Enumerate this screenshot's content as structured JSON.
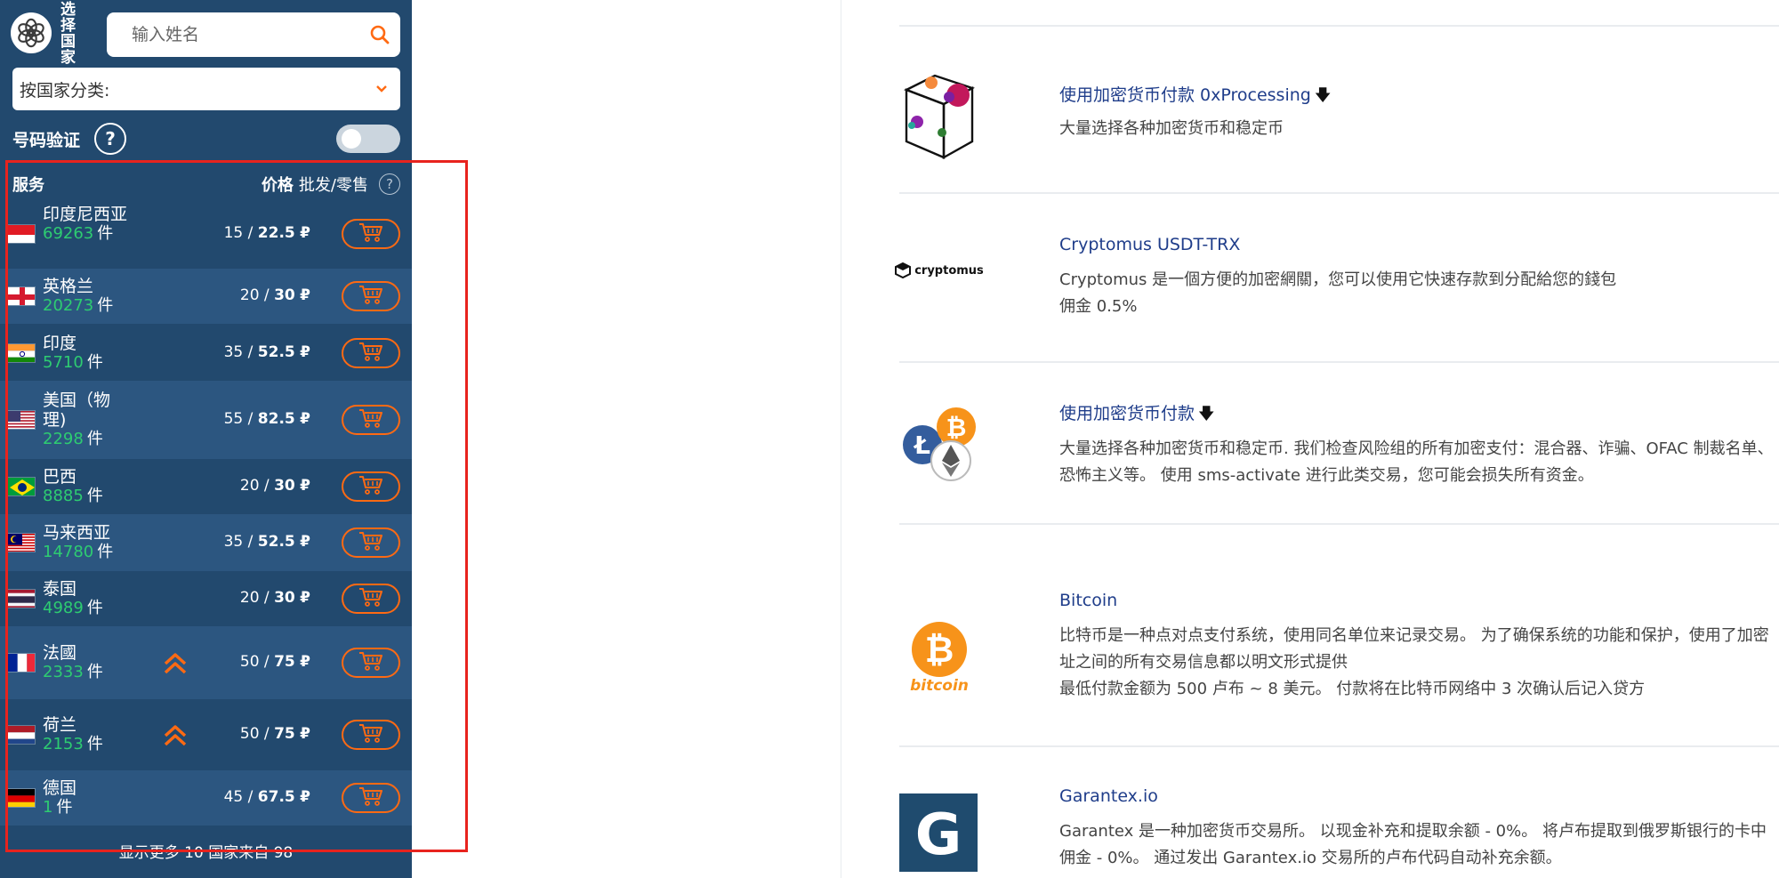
{
  "sidebar": {
    "choose_country": "选择国家",
    "search_placeholder": "输入姓名",
    "category_label": "按国家分类:",
    "verify_label": "号码验证",
    "help_q": "?",
    "header": {
      "service": "服务",
      "price": "价格",
      "price_sub": "批发/零售",
      "help": "?"
    },
    "unit": "件",
    "currency": "₽",
    "rows": [
      {
        "name": "印度尼西亚",
        "count": "69263",
        "wholesale": "15",
        "retail": "22.5",
        "flag": "indonesia"
      },
      {
        "name": "英格兰",
        "count": "20273",
        "wholesale": "20",
        "retail": "30",
        "flag": "england"
      },
      {
        "name": "印度",
        "count": "5710",
        "wholesale": "35",
        "retail": "52.5",
        "flag": "india"
      },
      {
        "name": "美国（物理)",
        "count": "2298",
        "wholesale": "55",
        "retail": "82.5",
        "flag": "usa"
      },
      {
        "name": "巴西",
        "count": "8885",
        "wholesale": "20",
        "retail": "30",
        "flag": "brazil"
      },
      {
        "name": "马来西亚",
        "count": "14780",
        "wholesale": "35",
        "retail": "52.5",
        "flag": "malaysia"
      },
      {
        "name": "泰国",
        "count": "4989",
        "wholesale": "20",
        "retail": "30",
        "flag": "thailand"
      },
      {
        "name": "法國",
        "count": "2333",
        "wholesale": "50",
        "retail": "75",
        "flag": "france",
        "promo": true
      },
      {
        "name": "荷兰",
        "count": "2153",
        "wholesale": "50",
        "retail": "75",
        "flag": "netherlands",
        "promo": true
      },
      {
        "name": "德国",
        "count": "1",
        "wholesale": "45",
        "retail": "67.5",
        "flag": "germany"
      }
    ],
    "show_more": "显示更多 10 国家来自 98"
  },
  "payments": [
    {
      "title": "使用加密货币付款 0xProcessing",
      "has_arrow": true,
      "desc": [
        "大量选择各种加密货币和稳定币"
      ],
      "logo": "cube-icon"
    },
    {
      "title": "Cryptomus USDT-TRX",
      "has_arrow": false,
      "desc": [
        "Cryptomus 是一個方便的加密網關，您可以使用它快速存款到分配給您的錢包",
        "佣金 0.5%"
      ],
      "logo": "cryptomus-logo",
      "logo_text": "cryptomus"
    },
    {
      "title": "使用加密货币付款",
      "has_arrow": true,
      "desc": [
        "大量选择各种加密货币和稳定币. 我们检查风险组的所有加密支付：混合器、诈骗、OFAC 制裁名单、",
        "恐怖主义等。 使用 sms-activate 进行此类交易，您可能会损失所有资金。"
      ],
      "logo": "crypto-coins-icon"
    },
    {
      "title": "Bitcoin",
      "has_arrow": false,
      "desc": [
        "比特币是一种点对点支付系统，使用同名单位来记录交易。 为了确保系统的功能和保护，使用了加密",
        "址之间的所有交易信息都以明文形式提供",
        "最低付款金额为 500 卢布 ~ 8 美元。 付款将在比特币网络中 3 次确认后记入贷方"
      ],
      "logo": "bitcoin-icon",
      "logo_text": "bitcoin"
    },
    {
      "title": "Garantex.io",
      "has_arrow": false,
      "desc": [
        "Garantex 是一种加密货币交易所。 以现金补充和提取余额 - 0%。 将卢布提取到俄罗斯银行的卡中",
        "佣金 - 0%。 通过发出 Garantex.io 交易所的卢布代码自动补充余额。"
      ],
      "logo": "garantex-logo"
    }
  ],
  "colors": {
    "sidebar_bg": "#22496e",
    "row_alt": "#2c5680",
    "accent": "#ff6a13",
    "count_green": "#2ecc71",
    "highlight": "#e8231e",
    "link_blue": "#1f3d8a"
  }
}
